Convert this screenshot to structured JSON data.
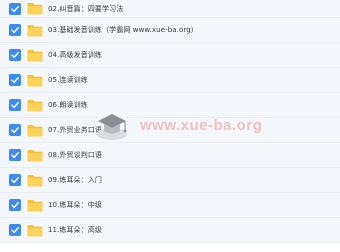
{
  "folders": [
    {
      "label": "02.纠音篇：四要学习法",
      "checked": true
    },
    {
      "label": "03.基础发音训练（学霸网 www.xue-ba.org）",
      "checked": true
    },
    {
      "label": "04.高级发音训练",
      "checked": true
    },
    {
      "label": "05.连读训练",
      "checked": true
    },
    {
      "label": "06.朗读训练",
      "checked": true
    },
    {
      "label": "07.外贸业务口语",
      "checked": true
    },
    {
      "label": "08.外贸谈判口语",
      "checked": true
    },
    {
      "label": "09.练耳朵：入门",
      "checked": true
    },
    {
      "label": "10.练耳朵：中级",
      "checked": true
    },
    {
      "label": "11.练耳朵：高级",
      "checked": true
    }
  ],
  "watermark": {
    "text": "www.xue-ba.org",
    "icon": "graduation-cap-icon"
  },
  "colors": {
    "checkbox": "#3c8cf0",
    "folder": "#f7c33a",
    "row_bg": "#f4f7fb",
    "watermark_text": "#ec968c"
  }
}
